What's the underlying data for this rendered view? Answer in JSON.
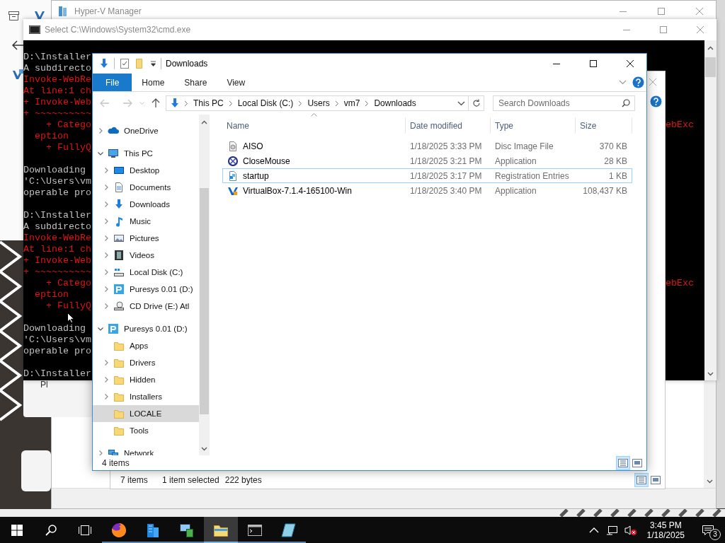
{
  "hyperv_window": {
    "title": "Hyper-V Manager"
  },
  "background_card": {
    "label": "Pl"
  },
  "cmd_window": {
    "title": "Select C:\\Windows\\System32\\cmd.exe",
    "blocks": [
      [
        {
          "text": "D:\\Installer",
          "kind": "output"
        },
        {
          "text": "A subdirecto",
          "kind": "output"
        },
        {
          "text": "Invoke-WebRe",
          "kind": "error"
        },
        {
          "text": "At line:1 ch",
          "kind": "error"
        },
        {
          "text": "+ Invoke-Web",
          "kind": "error"
        },
        {
          "text": "+ ~~~~~~~~~~",
          "kind": "error"
        },
        {
          "text": "    + Catego",
          "kind": "error",
          "tail": "ebExc"
        },
        {
          "text": "  eption",
          "kind": "error"
        },
        {
          "text": "    + FullyQ",
          "kind": "error"
        }
      ],
      [
        {
          "text": "Downloading",
          "kind": "output"
        },
        {
          "text": "'C:\\Users\\vm",
          "kind": "output"
        },
        {
          "text": "operable pro",
          "kind": "output"
        }
      ],
      [
        {
          "text": "D:\\Installer",
          "kind": "output"
        },
        {
          "text": "A subdirecto",
          "kind": "output"
        },
        {
          "text": "Invoke-WebRe",
          "kind": "error"
        },
        {
          "text": "At line:1 ch",
          "kind": "error"
        },
        {
          "text": "+ Invoke-Web",
          "kind": "error"
        },
        {
          "text": "+ ~~~~~~~~~~",
          "kind": "error"
        },
        {
          "text": "    + Catego",
          "kind": "error",
          "tail": "ebExc"
        },
        {
          "text": "  eption",
          "kind": "error"
        },
        {
          "text": "    + FullyQ",
          "kind": "error"
        }
      ],
      [
        {
          "text": "Downloading",
          "kind": "output"
        },
        {
          "text": "'C:\\Users\\vm",
          "kind": "output"
        },
        {
          "text": "operable pro",
          "kind": "output"
        }
      ],
      [
        {
          "text": "D:\\Installer",
          "kind": "output"
        }
      ]
    ]
  },
  "back_explorer": {
    "item_count": "7 items",
    "selection": "1 item selected",
    "selection_size": "222 bytes",
    "views": [
      {
        "kind": "details",
        "selected": true
      },
      {
        "kind": "tiles",
        "selected": false
      }
    ]
  },
  "explorer": {
    "title": "Downloads",
    "ribbon_tabs": [
      {
        "label": "File",
        "selected": true
      },
      {
        "label": "Home",
        "selected": false
      },
      {
        "label": "Share",
        "selected": false
      },
      {
        "label": "View",
        "selected": false
      }
    ],
    "breadcrumbs": [
      "This PC",
      "Local Disk (C:)",
      "Users",
      "vm7",
      "Downloads"
    ],
    "search": {
      "placeholder": "Search Downloads"
    },
    "nav": [
      {
        "label": "OneDrive",
        "kind": "cloud",
        "expanded": false,
        "selected": false
      },
      {
        "label": "This PC",
        "kind": "computer",
        "expanded": true,
        "selected": false,
        "children": [
          {
            "label": "Desktop",
            "kind": "desktop",
            "expanded": false,
            "selected": false
          },
          {
            "label": "Documents",
            "kind": "documents",
            "expanded": false,
            "selected": false
          },
          {
            "label": "Downloads",
            "kind": "downloads",
            "expanded": false,
            "selected": false
          },
          {
            "label": "Music",
            "kind": "music",
            "expanded": false,
            "selected": false
          },
          {
            "label": "Pictures",
            "kind": "pictures",
            "expanded": false,
            "selected": false
          },
          {
            "label": "Videos",
            "kind": "videos",
            "expanded": false,
            "selected": false
          },
          {
            "label": "Local Disk (C:)",
            "kind": "drive",
            "expanded": false,
            "selected": false
          },
          {
            "label": "Puresys 0.01 (D:)",
            "kind": "puresys",
            "expanded": false,
            "selected": false
          },
          {
            "label": "CD Drive (E:) Atl",
            "kind": "cd",
            "expanded": false,
            "selected": false
          }
        ]
      },
      {
        "label": "Puresys 0.01 (D:)",
        "kind": "puresys",
        "expanded": true,
        "selected": false,
        "children": [
          {
            "label": "Apps",
            "kind": "folder",
            "selected": false
          },
          {
            "label": "Drivers",
            "kind": "folder",
            "expanded": false,
            "selected": false
          },
          {
            "label": "Hidden",
            "kind": "folder",
            "expanded": false,
            "selected": false
          },
          {
            "label": "Installers",
            "kind": "folder",
            "expanded": false,
            "selected": false
          },
          {
            "label": "LOCALE",
            "kind": "folder",
            "selected": true
          },
          {
            "label": "Tools",
            "kind": "folder",
            "selected": false
          }
        ]
      },
      {
        "label": "Network",
        "kind": "network",
        "expanded": false,
        "selected": false
      }
    ],
    "columns": [
      {
        "label": "Name",
        "sorted": true
      },
      {
        "label": "Date modified",
        "sorted": false
      },
      {
        "label": "Type",
        "sorted": false
      },
      {
        "label": "Size",
        "sorted": false
      }
    ],
    "files": [
      {
        "name": "AISO",
        "date": "1/18/2025 3:33 PM",
        "type": "Disc Image File",
        "size": "370 KB",
        "kind": "disc-image",
        "selected": false
      },
      {
        "name": "CloseMouse",
        "date": "1/18/2025 3:21 PM",
        "type": "Application",
        "size": "28 KB",
        "kind": "application",
        "selected": false
      },
      {
        "name": "startup",
        "date": "1/18/2025 3:17 PM",
        "type": "Registration Entries",
        "size": "1 KB",
        "kind": "registry",
        "selected": true
      },
      {
        "name": "VirtualBox-7.1.4-165100-Win",
        "date": "1/18/2025 3:40 PM",
        "type": "Application",
        "size": "108,437 KB",
        "kind": "installer",
        "selected": false
      }
    ],
    "status": "4 items",
    "views": [
      {
        "kind": "details",
        "selected": true
      },
      {
        "kind": "tiles",
        "selected": false
      }
    ]
  },
  "taskbar": {
    "apps": [
      {
        "kind": "browser",
        "running": true,
        "active": false
      },
      {
        "kind": "building",
        "running": true,
        "active": false
      },
      {
        "kind": "server",
        "running": true,
        "active": false
      },
      {
        "kind": "folder",
        "running": true,
        "active": true
      },
      {
        "kind": "terminal",
        "running": true,
        "active": false
      },
      {
        "kind": "notepad",
        "running": true,
        "active": false
      }
    ],
    "clock": {
      "time": "3:45 PM",
      "date": "1/18/2025"
    },
    "notification_count": "3"
  }
}
